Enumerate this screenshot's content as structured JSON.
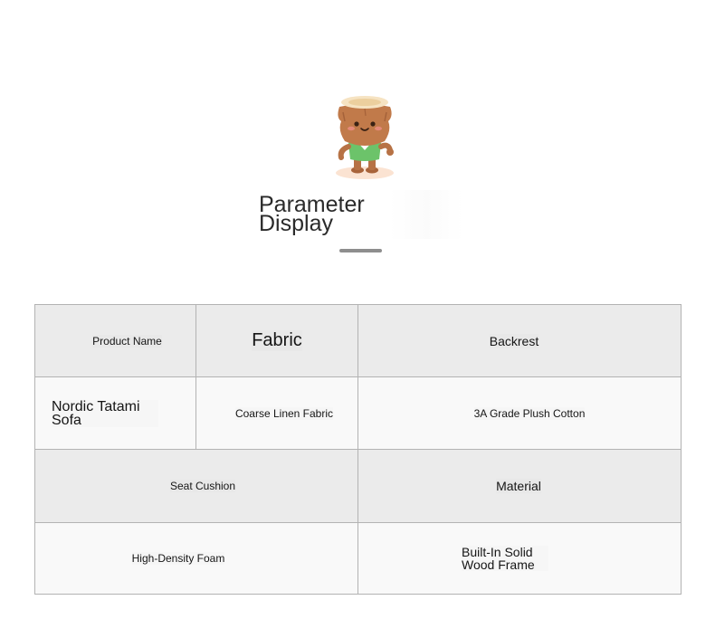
{
  "header": {
    "title": "Parameter Display",
    "mascot_icon": "tree-stump-mascot-icon"
  },
  "table": {
    "row1": {
      "product_name_label": "Product Name",
      "fabric_label": "Fabric",
      "backrest_label": "Backrest"
    },
    "row2": {
      "product_name_value": "Nordic Tatami Sofa",
      "fabric_value": "Coarse Linen Fabric",
      "backrest_value": "3A Grade Plush Cotton"
    },
    "row3": {
      "seat_cushion_label": "Seat Cushion",
      "material_label": "Material"
    },
    "row4": {
      "seat_cushion_value": "High-Density Foam",
      "material_value": "Built-In Solid Wood Frame"
    }
  },
  "colors": {
    "header_row_bg": "#ebebeb",
    "body_row_bg": "#f9f9f9",
    "border": "#b3b3b3",
    "underline": "#8e8e8e"
  }
}
